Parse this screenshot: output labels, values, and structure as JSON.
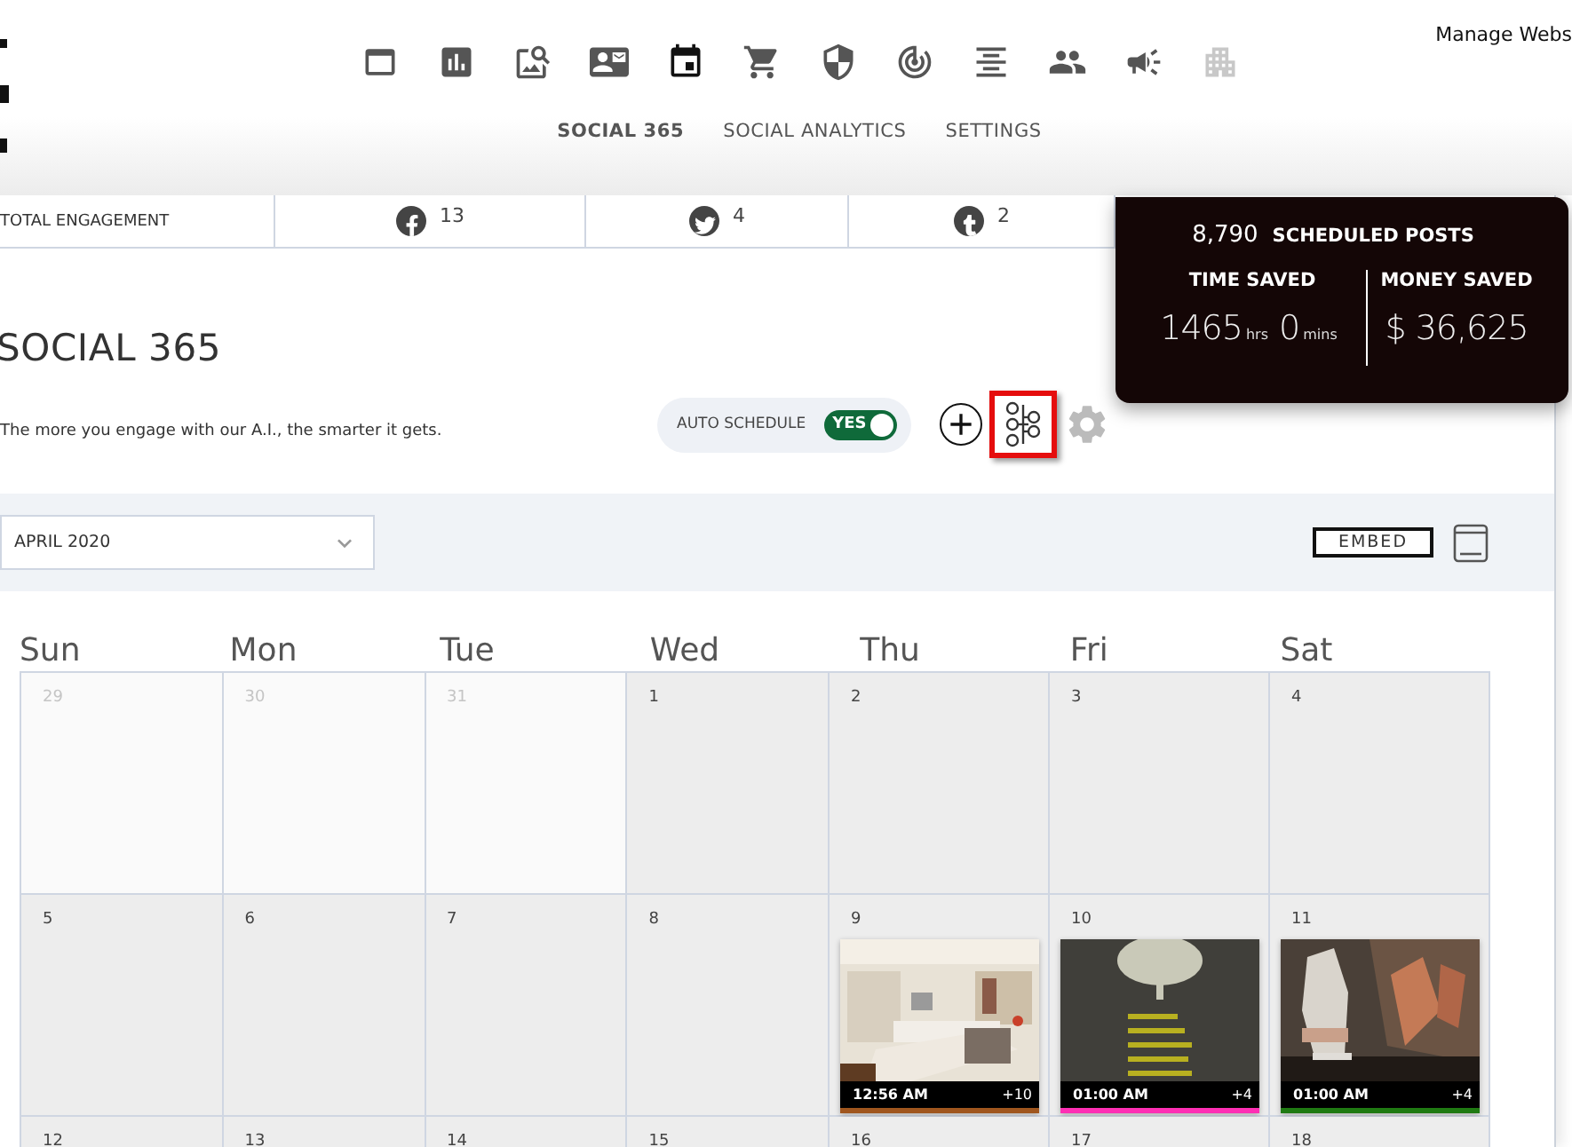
{
  "header": {
    "manage_link": "Manage Webs",
    "nav_icons": [
      {
        "kind": "window",
        "selected": false,
        "disabled": false
      },
      {
        "kind": "chart",
        "selected": false,
        "disabled": false
      },
      {
        "kind": "search",
        "selected": false,
        "disabled": false
      },
      {
        "kind": "contact",
        "selected": false,
        "disabled": false
      },
      {
        "kind": "calendar",
        "selected": true,
        "disabled": false
      },
      {
        "kind": "cart",
        "selected": false,
        "disabled": false
      },
      {
        "kind": "shield",
        "selected": false,
        "disabled": false
      },
      {
        "kind": "target",
        "selected": false,
        "disabled": false
      },
      {
        "kind": "align",
        "selected": false,
        "disabled": false
      },
      {
        "kind": "people",
        "selected": false,
        "disabled": false
      },
      {
        "kind": "megaphone",
        "selected": false,
        "disabled": false
      },
      {
        "kind": "building",
        "selected": false,
        "disabled": true
      }
    ],
    "tabs": [
      {
        "label": "SOCIAL 365",
        "selected": true
      },
      {
        "label": "SOCIAL ANALYTICS",
        "selected": false
      },
      {
        "label": "SETTINGS",
        "selected": false
      }
    ]
  },
  "engagement": {
    "label": "TOTAL ENGAGEMENT",
    "networks": [
      {
        "kind": "facebook",
        "count": "13"
      },
      {
        "kind": "twitter",
        "count": "4"
      },
      {
        "kind": "tumblr",
        "count": "2"
      }
    ]
  },
  "stats": {
    "scheduled_count": "8,790",
    "scheduled_label": "SCHEDULED POSTS",
    "time_label": "TIME SAVED",
    "hours": "1465",
    "hours_unit": "hrs",
    "minutes": "0",
    "minutes_unit": "mins",
    "money_label": "MONEY SAVED",
    "money": "$ 36,625"
  },
  "page": {
    "title": "SOCIAL 365",
    "subtitle": "The more you engage with our A.I., the smarter it gets.",
    "auto_schedule": {
      "label": "AUTO SCHEDULE",
      "on": true,
      "on_text": "YES"
    },
    "hierarchy_highlighted": true
  },
  "toolbar": {
    "month": "APRIL 2020",
    "embed": "EMBED"
  },
  "calendar": {
    "weekdays": [
      "Sun",
      "Mon",
      "Tue",
      "Wed",
      "Thu",
      "Fri",
      "Sat"
    ],
    "weeks": [
      [
        {
          "day": "29",
          "outside": true
        },
        {
          "day": "30",
          "outside": true
        },
        {
          "day": "31",
          "outside": true
        },
        {
          "day": "1",
          "outside": false
        },
        {
          "day": "2",
          "outside": false
        },
        {
          "day": "3",
          "outside": false
        },
        {
          "day": "4",
          "outside": false
        }
      ],
      [
        {
          "day": "5",
          "outside": false
        },
        {
          "day": "6",
          "outside": false
        },
        {
          "day": "7",
          "outside": false
        },
        {
          "day": "8",
          "outside": false
        },
        {
          "day": "9",
          "outside": false,
          "post": {
            "kind": "picture",
            "time": "12:56 AM",
            "more": "+10",
            "color": "#a0561e"
          }
        },
        {
          "day": "10",
          "outside": false,
          "post": {
            "kind": "picture",
            "time": "01:00 AM",
            "more": "+4",
            "color": "#ff2fb4"
          }
        },
        {
          "day": "11",
          "outside": false,
          "post": {
            "kind": "picture",
            "time": "01:00 AM",
            "more": "+4",
            "color": "#1f7a12"
          }
        }
      ],
      [
        {
          "day": "12",
          "outside": false
        },
        {
          "day": "13",
          "outside": false
        },
        {
          "day": "14",
          "outside": false
        },
        {
          "day": "15",
          "outside": false
        },
        {
          "day": "16",
          "outside": false
        },
        {
          "day": "17",
          "outside": false
        },
        {
          "day": "18",
          "outside": false
        }
      ]
    ]
  }
}
